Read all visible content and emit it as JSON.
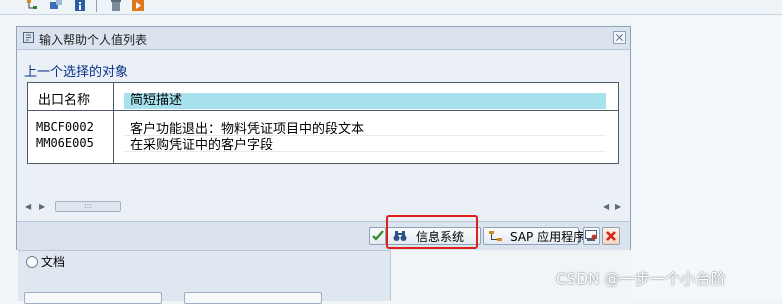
{
  "dialog": {
    "title": "输入帮助个人值列表",
    "subtitle": "上一个选择的对象",
    "columns": {
      "name": "出口名称",
      "description": "简短描述"
    },
    "rows": [
      {
        "name": "MBCF0002",
        "description": "客户功能退出：物料凭证项目中的段文本"
      },
      {
        "name": "MM06E005",
        "description": "在采购凭证中的客户字段"
      }
    ],
    "buttons": {
      "info_system": "信息系统",
      "sap_app": "SAP 应用程序"
    }
  },
  "background": {
    "radio_label": "文档"
  },
  "watermark": "CSDN @一步一个小台阶",
  "colors": {
    "highlight": "#e0201c",
    "selected_header": "#a7e1ee",
    "subtitle": "#0a2f86"
  }
}
